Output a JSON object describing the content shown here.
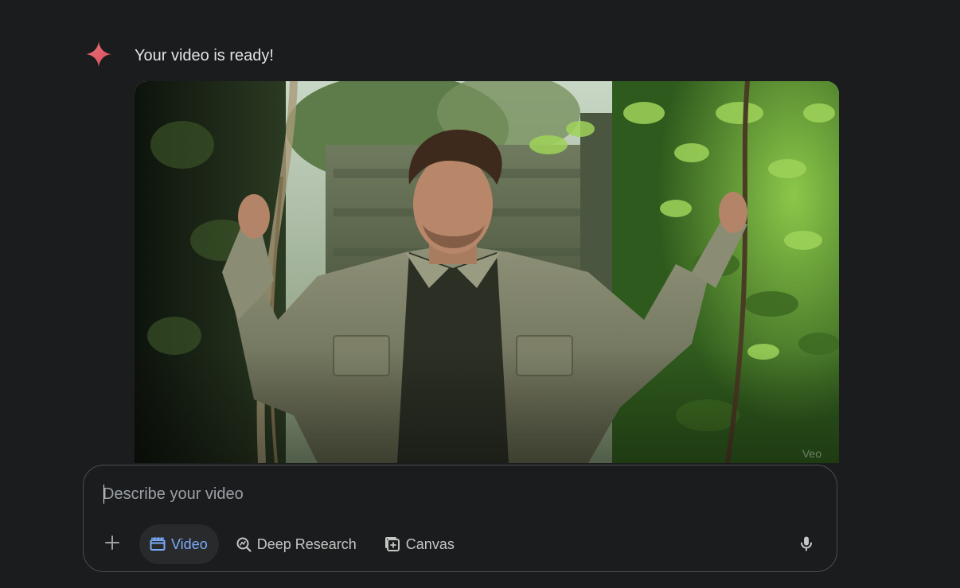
{
  "message": {
    "text": "Your video is ready!",
    "avatar_icon": "gemini-spark-icon",
    "avatar_color": "#e06c75"
  },
  "video": {
    "watermark": "Veo"
  },
  "composer": {
    "placeholder": "Describe your video",
    "value": "",
    "tools": [
      {
        "label": "Video",
        "icon": "clapperboard-icon",
        "active": true
      },
      {
        "label": "Deep Research",
        "icon": "deep-research-icon",
        "active": false
      },
      {
        "label": "Canvas",
        "icon": "canvas-icon",
        "active": false
      }
    ],
    "add_icon": "plus-icon",
    "mic_icon": "microphone-icon"
  },
  "colors": {
    "background": "#1b1c1d",
    "text": "#e3e3e3",
    "accent": "#7cacf8",
    "muted": "#c4c7c5",
    "border": "#4a4c4f"
  }
}
